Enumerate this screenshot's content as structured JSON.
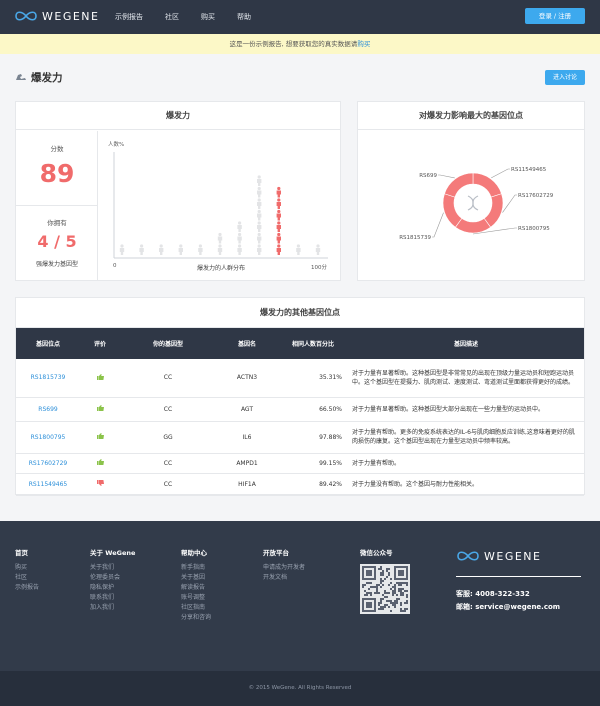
{
  "nav": {
    "brand": "WEGENE",
    "items": [
      "示例报告",
      "社区",
      "购买",
      "帮助"
    ],
    "login_label": "登录 / 注册"
  },
  "notice": {
    "text": "这是一份示例报告, 想要获取您的真实数据请",
    "link": "购买"
  },
  "page": {
    "title": "爆发力",
    "discuss_label": "进入讨论",
    "title_icon": "muscle-icon"
  },
  "summary": {
    "title": "爆发力",
    "score_label": "分数",
    "score": "89",
    "have_label": "你拥有",
    "have_value": "4 / 5",
    "have_sub": "强爆发力基因型"
  },
  "chart_data": [
    {
      "type": "bar",
      "ylabel": "人数%",
      "xlabel": "爆发力的人群分布",
      "x_range_labels": [
        "0",
        "100分"
      ],
      "bins": 11,
      "values": [
        1,
        1,
        1,
        1,
        1,
        2,
        3,
        7,
        6,
        1,
        1
      ],
      "highlight_bin": 8,
      "colors": {
        "base": "#e3e4e6",
        "highlight": "#f06b6b"
      }
    },
    {
      "type": "pie",
      "title": "对爆发力影响最大的基因位点",
      "categories": [
        "RS11549465",
        "RS17602729",
        "RS1800795",
        "RS1815739",
        "RS699"
      ],
      "values": [
        20,
        20,
        20,
        20,
        20
      ],
      "color": "#f47a7a",
      "center_icon": "dna-icon"
    }
  ],
  "genes": {
    "title": "爆发力的其他基因位点",
    "headers": [
      "基因位点",
      "评价",
      "你的基因型",
      "基因名",
      "相同人数百分比",
      "基因描述"
    ],
    "rows": [
      {
        "locus": "RS1815739",
        "rating": "up",
        "genotype": "CC",
        "gene": "ACTN3",
        "pct": "35.31%",
        "desc": "对于力量有显著帮助。这种基因型是非常常见的出现在顶级力量运动员和短跑运动员中。这个基因型在提摄力、肌肉测试、速度测试、弯道测试里面都获得更好的成绩。"
      },
      {
        "locus": "RS699",
        "rating": "up",
        "genotype": "CC",
        "gene": "AGT",
        "pct": "66.50%",
        "desc": "对于力量有显著帮助。这种基因型大部分出现在一些力量型的运动员中。"
      },
      {
        "locus": "RS1800795",
        "rating": "up",
        "genotype": "GG",
        "gene": "IL6",
        "pct": "97.88%",
        "desc": "对于力量有帮助。更多的免疫系统表达的IL-6与肌肉细胞反应训练,这意味着更好的肌肉损伤的康复。这个基因型出现在力量型运动员中频率较高。"
      },
      {
        "locus": "RS17602729",
        "rating": "up",
        "genotype": "CC",
        "gene": "AMPD1",
        "pct": "99.15%",
        "desc": "对于力量有帮助。"
      },
      {
        "locus": "RS11549465",
        "rating": "down",
        "genotype": "CC",
        "gene": "HIF1A",
        "pct": "89.42%",
        "desc": "对于力量没有帮助。这个基因与耐力性能相关。"
      }
    ]
  },
  "footer": {
    "cols": [
      {
        "title": "首页",
        "items": [
          "购买",
          "社区",
          "示例报告"
        ]
      },
      {
        "title": "关于 WeGene",
        "items": [
          "关于我们",
          "伦理委员会",
          "隐私保护",
          "联系我们",
          "加入我们"
        ]
      },
      {
        "title": "帮助中心",
        "items": [
          "新手指南",
          "关于基因",
          "解读报告",
          "账号调整",
          "社区指南",
          "分享和咨询"
        ]
      },
      {
        "title": "开放平台",
        "items": [
          "申请成为开发者",
          "开发文档"
        ]
      },
      {
        "title": "微信公众号",
        "items": []
      }
    ],
    "brand": "WEGENE",
    "phone_label": "客服: ",
    "phone": "4008-322-332",
    "email_label": "邮箱: ",
    "email": "service@wegene.com",
    "copyright": "© 2015 WeGene. All Rights Reserved"
  }
}
